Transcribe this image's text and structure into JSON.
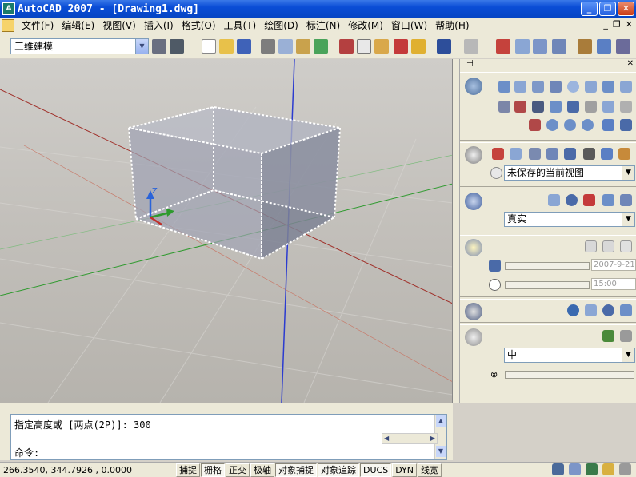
{
  "window": {
    "title": "AutoCAD 2007 - [Drawing1.dwg]",
    "app_icon": "autocad-logo-icon"
  },
  "menu": [
    {
      "label": "文件(F)"
    },
    {
      "label": "编辑(E)"
    },
    {
      "label": "视图(V)"
    },
    {
      "label": "插入(I)"
    },
    {
      "label": "格式(O)"
    },
    {
      "label": "工具(T)"
    },
    {
      "label": "绘图(D)"
    },
    {
      "label": "标注(N)"
    },
    {
      "label": "修改(M)"
    },
    {
      "label": "窗口(W)"
    },
    {
      "label": "帮助(H)"
    }
  ],
  "toolbar": {
    "workspace": "三维建模"
  },
  "palette": {
    "view_select": "未保存的当前视图",
    "visual_style": "真实",
    "date_value": "2007-9-21",
    "time_value": "15:00",
    "material_quality": "中"
  },
  "command": {
    "history": "指定高度或 [两点(2P)]: 300",
    "prompt": "命令:"
  },
  "status": {
    "coords": "266.3540,   344.7926 , 0.0000",
    "buttons": [
      {
        "label": "捕捉",
        "on": false
      },
      {
        "label": "栅格",
        "on": true
      },
      {
        "label": "正交",
        "on": false
      },
      {
        "label": "极轴",
        "on": false
      },
      {
        "label": "对象捕捉",
        "on": true
      },
      {
        "label": "对象追踪",
        "on": true
      },
      {
        "label": "DUCS",
        "on": true
      },
      {
        "label": "DYN",
        "on": false
      },
      {
        "label": "线宽",
        "on": false
      }
    ]
  },
  "ucs": {
    "z_label": "Z"
  },
  "colors": {
    "x_axis": "#a0302a",
    "y_axis": "#2e9a2e",
    "z_axis": "#2b3bd0",
    "title_bar": "#0a4dd6"
  }
}
